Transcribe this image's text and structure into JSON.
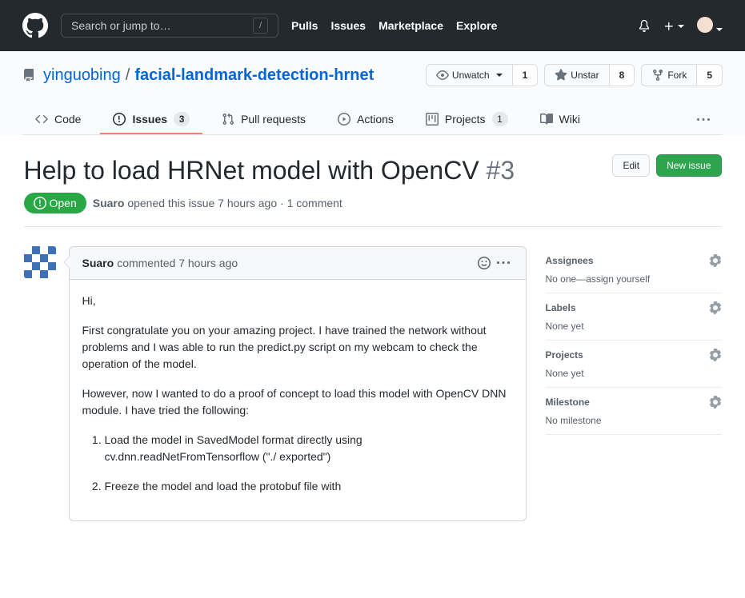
{
  "header": {
    "search_placeholder": "Search or jump to…",
    "nav": {
      "pulls": "Pulls",
      "issues": "Issues",
      "marketplace": "Marketplace",
      "explore": "Explore"
    }
  },
  "repo": {
    "owner": "yinguobing",
    "name": "facial-landmark-detection-hrnet",
    "watch_label": "Unwatch",
    "watch_count": "1",
    "star_label": "Unstar",
    "star_count": "8",
    "fork_label": "Fork",
    "fork_count": "5"
  },
  "tabs": {
    "code": "Code",
    "issues": "Issues",
    "issues_count": "3",
    "pulls": "Pull requests",
    "actions": "Actions",
    "projects": "Projects",
    "projects_count": "1",
    "wiki": "Wiki"
  },
  "issue": {
    "title": "Help to load HRNet model with OpenCV",
    "number": "#3",
    "edit_btn": "Edit",
    "new_btn": "New issue",
    "state": "Open",
    "meta_author": "Suaro",
    "meta_text": "opened this issue 7 hours ago · 1 comment"
  },
  "comment": {
    "author": "Suaro",
    "meta": "commented 7 hours ago",
    "p1": "Hi,",
    "p2": "First congratulate you on your amazing project. I have trained the network without problems and I was able to run the predict.py script on my webcam to check the operation of the model.",
    "p3": "However, now I wanted to do a proof of concept to load this model with OpenCV DNN module. I have tried the following:",
    "li1": "Load the model in SavedModel format directly using cv.dnn.readNetFromTensorflow (\"./ exported\")",
    "li2": "Freeze the model and load the protobuf file with"
  },
  "sidebar": {
    "assignees_title": "Assignees",
    "assignees_body": "No one—assign yourself",
    "labels_title": "Labels",
    "labels_body": "None yet",
    "projects_title": "Projects",
    "projects_body": "None yet",
    "milestone_title": "Milestone",
    "milestone_body": "No milestone"
  }
}
